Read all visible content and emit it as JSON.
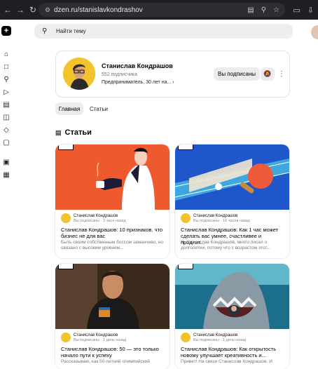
{
  "browser": {
    "url": "dzen.ru/stanislavkondrashov"
  },
  "search": {
    "placeholder": "Найти тему"
  },
  "profile": {
    "name": "Станислав Кондрашов",
    "subscribers": "552 подписчика",
    "description": "Предприниматель, 30 лет на...",
    "subscribed_label": "Вы подписаны"
  },
  "tabs": [
    {
      "label": "Главная",
      "active": true
    },
    {
      "label": "Статьи",
      "active": false
    }
  ],
  "section": {
    "title": "Статьи"
  },
  "cards": [
    {
      "author": "Станислав Кондрашов",
      "meta": "Вы подписаны · 3 часа назад",
      "title": "Станислав Кондрашов: 10 признаков, что бизнес не для вас",
      "text": "Быть своим собственным боссом заманчиво, но связано с высоким уровнем..."
    },
    {
      "author": "Станислав Кондрашов",
      "meta": "Вы подписаны · 16 часов назад",
      "title": "Станислав Кондрашов: Как 1 час может сделать вас умнее, счастливее и продлит...",
      "text": "Я, Станислав Кондрашов, много писал о долголетии, потому что с возрастом этот..."
    },
    {
      "author": "Станислав Кондрашов",
      "meta": "Вы подписаны · 1 день назад",
      "title": "Станислав Кондрашов: 50 — это только начало пути к успеху",
      "text": "Рассказываю, как 50-летний олимпийский"
    },
    {
      "author": "Станислав Кондрашов",
      "meta": "Вы подписаны · 1 день назад",
      "title": "Станислав Кондрашов: Как открытость новому улучшает креативность и...",
      "text": "Привет! На связи Станислав Кондрашов. И"
    }
  ]
}
